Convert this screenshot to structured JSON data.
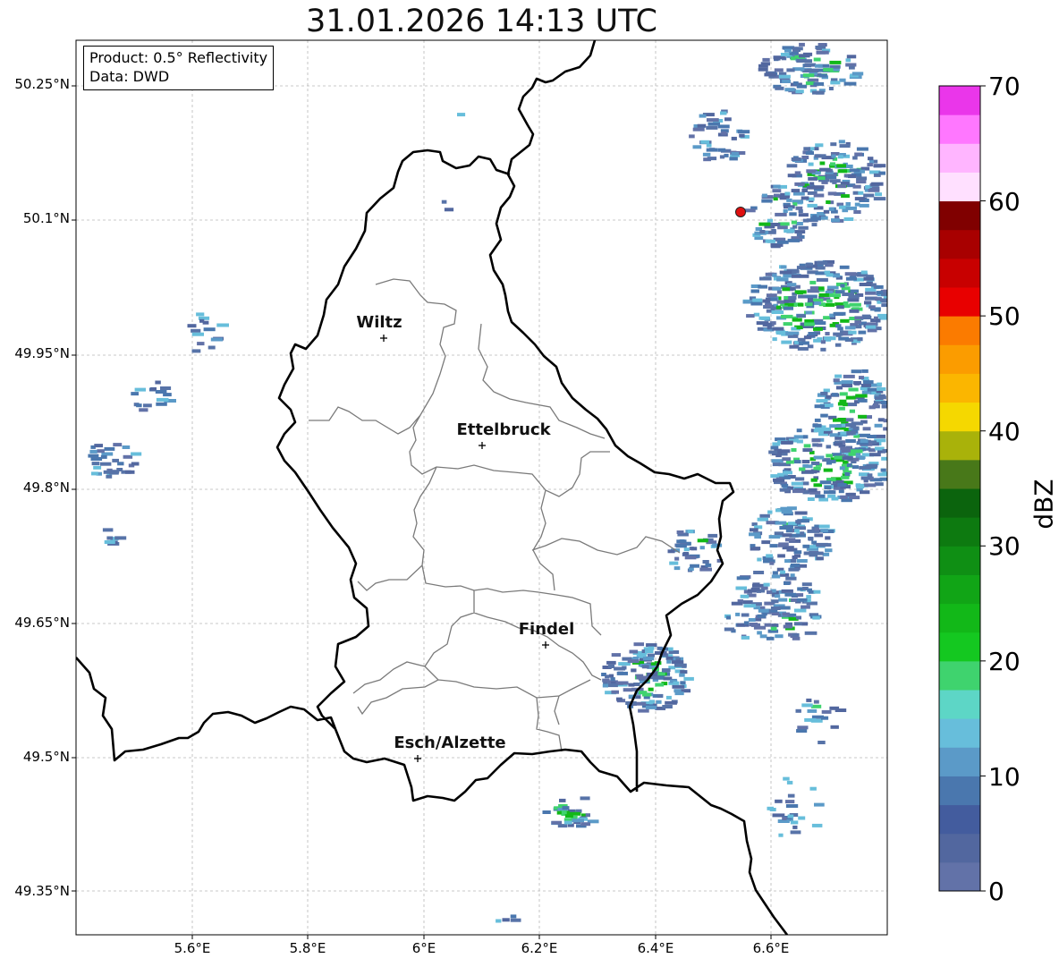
{
  "title": "31.01.2026 14:13 UTC",
  "info": {
    "product": "Product: 0.5° Reflectivity",
    "data": "Data: DWD"
  },
  "lat_ticks": [
    "50.25°N",
    "50.1°N",
    "49.95°N",
    "49.8°N",
    "49.65°N",
    "49.5°N",
    "49.35°N"
  ],
  "lon_ticks": [
    "5.6°E",
    "5.8°E",
    "6°E",
    "6.2°E",
    "6.4°E",
    "6.6°E"
  ],
  "cities": [
    {
      "name": "Wiltz"
    },
    {
      "name": "Ettelbruck"
    },
    {
      "name": "Findel"
    },
    {
      "name": "Esch/Alzette"
    }
  ],
  "colorbar": {
    "label": "dBZ",
    "ticks": [
      "0",
      "10",
      "20",
      "30",
      "40",
      "50",
      "60",
      "70"
    ],
    "colors": [
      "#6272a8",
      "#52679f",
      "#435c9e",
      "#4a77ae",
      "#5b9ac8",
      "#67bedb",
      "#5dd6c6",
      "#3fd36e",
      "#14c820",
      "#12b818",
      "#11a516",
      "#0f8f14",
      "#0d7a10",
      "#0b640d",
      "#487819",
      "#a9b20a",
      "#f5d800",
      "#fbb600",
      "#fb9c00",
      "#fb7b00",
      "#e80000",
      "#c80000",
      "#a80000",
      "#800000",
      "#ffe0ff",
      "#ffb5ff",
      "#ff77ff",
      "#ea36ea"
    ]
  },
  "radar_site": {
    "color": "#e01010"
  }
}
